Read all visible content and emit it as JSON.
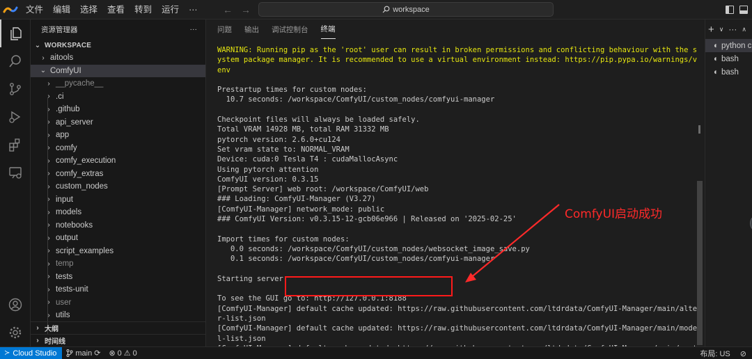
{
  "titlebar": {
    "menu": [
      "文件",
      "编辑",
      "选择",
      "查看",
      "转到",
      "运行",
      "···"
    ],
    "search_text": "workspace"
  },
  "sidebar": {
    "title": "资源管理器",
    "more": "···",
    "workspace_label": "WORKSPACE",
    "items": [
      {
        "label": "aitools",
        "expanded": false,
        "dim": false
      },
      {
        "label": "ComfyUI",
        "expanded": true,
        "dim": false
      },
      {
        "label": "__pycache__",
        "expanded": false,
        "dim": true
      },
      {
        "label": ".ci",
        "expanded": false,
        "dim": false
      },
      {
        "label": ".github",
        "expanded": false,
        "dim": false
      },
      {
        "label": "api_server",
        "expanded": false,
        "dim": false
      },
      {
        "label": "app",
        "expanded": false,
        "dim": false
      },
      {
        "label": "comfy",
        "expanded": false,
        "dim": false
      },
      {
        "label": "comfy_execution",
        "expanded": false,
        "dim": false
      },
      {
        "label": "comfy_extras",
        "expanded": false,
        "dim": false
      },
      {
        "label": "custom_nodes",
        "expanded": false,
        "dim": false
      },
      {
        "label": "input",
        "expanded": false,
        "dim": false
      },
      {
        "label": "models",
        "expanded": false,
        "dim": false
      },
      {
        "label": "notebooks",
        "expanded": false,
        "dim": false
      },
      {
        "label": "output",
        "expanded": false,
        "dim": false
      },
      {
        "label": "script_examples",
        "expanded": false,
        "dim": false
      },
      {
        "label": "temp",
        "expanded": false,
        "dim": true
      },
      {
        "label": "tests",
        "expanded": false,
        "dim": false
      },
      {
        "label": "tests-unit",
        "expanded": false,
        "dim": false
      },
      {
        "label": "user",
        "expanded": false,
        "dim": true
      },
      {
        "label": "utils",
        "expanded": false,
        "dim": false
      }
    ],
    "outline_label": "大纲",
    "timeline_label": "时间线"
  },
  "panel": {
    "tabs": [
      "问题",
      "输出",
      "调试控制台",
      "终端"
    ],
    "active_tab": 3,
    "terminal_lines": [
      {
        "text": "WARNING: Running pip as the 'root' user can result in broken permissions and conflicting behaviour with the system package manager. It is recommended to use a virtual environment instead: https://pip.pypa.io/warnings/venv",
        "warn": true
      },
      {
        "text": "",
        "warn": false
      },
      {
        "text": "Prestartup times for custom nodes:",
        "warn": false
      },
      {
        "text": "  10.7 seconds: /workspace/ComfyUI/custom_nodes/comfyui-manager",
        "warn": false
      },
      {
        "text": "",
        "warn": false
      },
      {
        "text": "Checkpoint files will always be loaded safely.",
        "warn": false
      },
      {
        "text": "Total VRAM 14928 MB, total RAM 31332 MB",
        "warn": false
      },
      {
        "text": "pytorch version: 2.6.0+cu124",
        "warn": false
      },
      {
        "text": "Set vram state to: NORMAL_VRAM",
        "warn": false
      },
      {
        "text": "Device: cuda:0 Tesla T4 : cudaMallocAsync",
        "warn": false
      },
      {
        "text": "Using pytorch attention",
        "warn": false
      },
      {
        "text": "ComfyUI version: 0.3.15",
        "warn": false
      },
      {
        "text": "[Prompt Server] web root: /workspace/ComfyUI/web",
        "warn": false
      },
      {
        "text": "### Loading: ComfyUI-Manager (V3.27)",
        "warn": false
      },
      {
        "text": "[ComfyUI-Manager] network_mode: public",
        "warn": false
      },
      {
        "text": "### ComfyUI Version: v0.3.15-12-gcb06e966 | Released on '2025-02-25'",
        "warn": false
      },
      {
        "text": "",
        "warn": false
      },
      {
        "text": "Import times for custom nodes:",
        "warn": false
      },
      {
        "text": "   0.0 seconds: /workspace/ComfyUI/custom_nodes/websocket_image_save.py",
        "warn": false
      },
      {
        "text": "   0.1 seconds: /workspace/ComfyUI/custom_nodes/comfyui-manager",
        "warn": false
      },
      {
        "text": "",
        "warn": false
      },
      {
        "text": "Starting server",
        "warn": false
      },
      {
        "text": "",
        "warn": false
      },
      {
        "text": "To see the GUI go to: http://127.0.0.1:8188",
        "warn": false
      },
      {
        "text": "[ComfyUI-Manager] default cache updated: https://raw.githubusercontent.com/ltdrdata/ComfyUI-Manager/main/alter-list.json",
        "warn": false
      },
      {
        "text": "[ComfyUI-Manager] default cache updated: https://raw.githubusercontent.com/ltdrdata/ComfyUI-Manager/main/model-list.json",
        "warn": false
      },
      {
        "text": "[ComfyUI-Manager] default cache updated: https://raw.githubusercontent.com/ltdrdata/ComfyUI-Manager/main/custom-nod",
        "warn": false
      }
    ]
  },
  "terminals": {
    "add": "+",
    "chevron": "∨",
    "more": "···",
    "collapse": "∧",
    "items": [
      "python c",
      "bash",
      "bash"
    ]
  },
  "annotation": {
    "text": "ComfyUI启动成功",
    "color": "#ff2a2a"
  },
  "statusbar": {
    "remote": "Cloud Studio",
    "branch": "main",
    "errors": "0",
    "warnings": "0",
    "layout": "布局: US"
  },
  "colors": {
    "warning_text": "#e5e510",
    "accent": "#0078d4"
  }
}
